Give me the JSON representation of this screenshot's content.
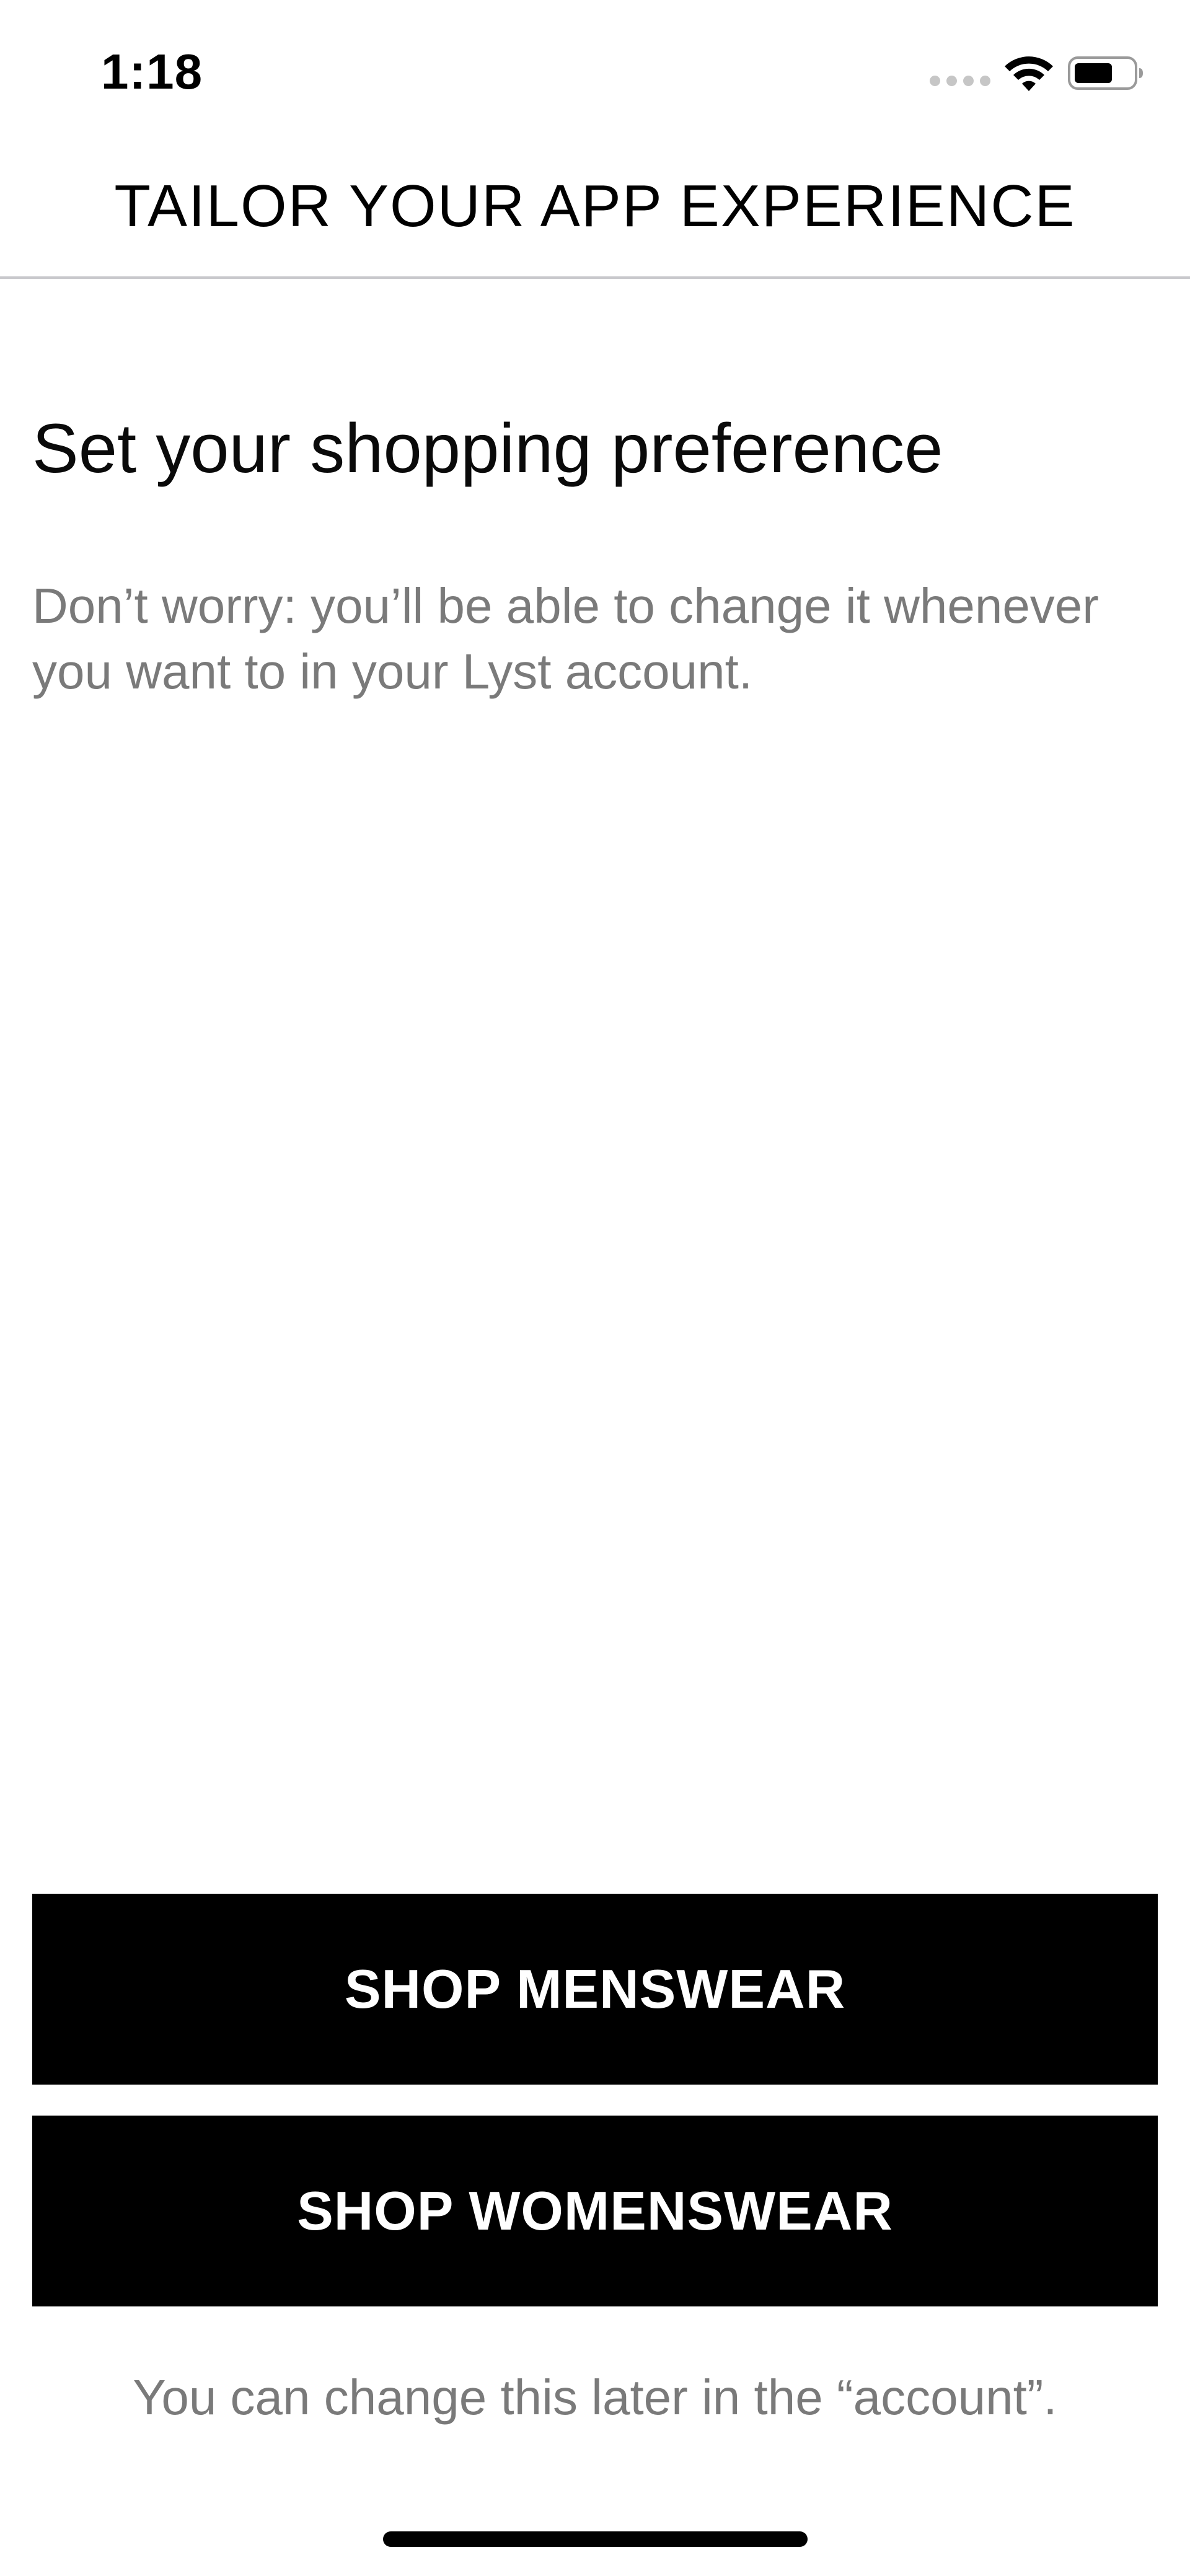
{
  "status_bar": {
    "time": "1:18",
    "icons": [
      "signal-dots-icon",
      "wifi-icon",
      "battery-icon"
    ]
  },
  "header": {
    "title": "TAILOR YOUR APP EXPERIENCE"
  },
  "content": {
    "heading": "Set your shopping preference",
    "subtext": "Don’t worry: you’ll be able to change it whenever you want to in your Lyst account."
  },
  "actions": {
    "menswear_label": "SHOP MENSWEAR",
    "womenswear_label": "SHOP WOMENSWEAR"
  },
  "footer": {
    "note": "You can change this later in the “account”."
  },
  "colors": {
    "button_bg": "#000000",
    "button_text": "#ffffff",
    "secondary_text": "#7a7a7a",
    "divider": "#c8c8cc"
  }
}
